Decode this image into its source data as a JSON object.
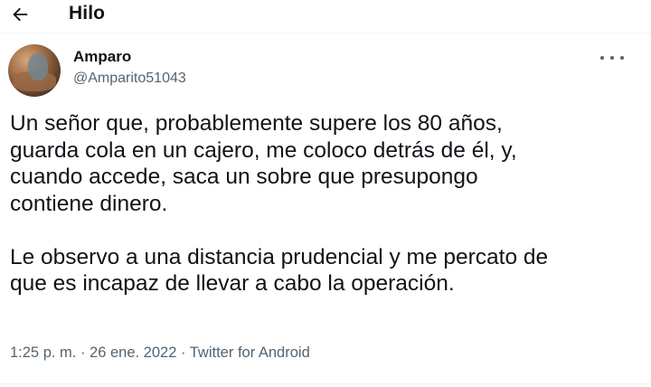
{
  "header": {
    "title": "Hilo",
    "back_icon": "arrow-left-icon"
  },
  "tweet": {
    "author": {
      "display_name": "Amparo",
      "handle": "@Amparito51043",
      "avatar_icon": "avatar-photo"
    },
    "more_icon": "more-horizontal-icon",
    "paragraphs": [
      [
        "Un señor que, probablemente supere los 80 años,",
        "guarda cola en un cajero, me coloco detrás de él, y,",
        "cuando accede, saca un sobre que presupongo",
        "contiene dinero."
      ],
      [
        "Le observo a una distancia prudencial y me percato de",
        "que es incapaz de llevar a cabo la operación."
      ]
    ],
    "meta": {
      "time": "1:25 p. m.",
      "separator": " · ",
      "date": "26 ene. 2022",
      "source": "Twitter for Android"
    }
  },
  "colors": {
    "text": "#0f1419",
    "secondary": "#536471",
    "background": "#ffffff"
  }
}
